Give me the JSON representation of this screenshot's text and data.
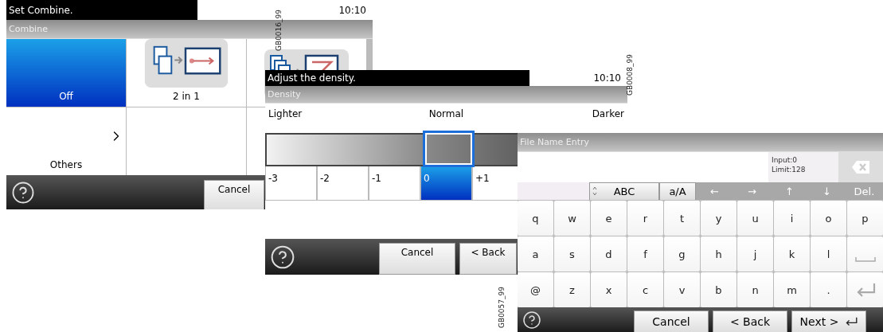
{
  "combine_screen": {
    "message": "Set Combine.",
    "time": "10:10",
    "title": "Combine",
    "options": [
      {
        "kind": "option",
        "label": "Off",
        "selected": true
      },
      {
        "kind": "option",
        "label": "2 in 1",
        "selected": false
      },
      {
        "kind": "icon_only",
        "selected": false
      },
      {
        "kind": "more",
        "label": "Others"
      }
    ],
    "buttons": [
      "Cancel"
    ]
  },
  "density_screen": {
    "message": "Adjust the density.",
    "time": "10:10",
    "title": "Density",
    "scale_labels": [
      "Lighter",
      "Normal",
      "Darker"
    ],
    "steps": [
      {
        "label": "-3",
        "selected": false
      },
      {
        "label": "-2",
        "selected": false
      },
      {
        "label": "-1",
        "selected": false
      },
      {
        "label": "0",
        "selected": true
      },
      {
        "label": "+1",
        "selected": false
      }
    ],
    "buttons": [
      "Cancel",
      "< Back"
    ]
  },
  "file_name_screen": {
    "title": "File Name Entry",
    "input_count": "Input:0",
    "limit": "Limit:128",
    "mode_keys": [
      {
        "kind": "cycle",
        "label": "ABC"
      },
      {
        "kind": "plain",
        "label": "a/A"
      }
    ],
    "nav_keys": [
      {
        "label": "←",
        "disabled": true
      },
      {
        "label": "→",
        "disabled": true
      },
      {
        "label": "↑",
        "disabled": true
      },
      {
        "label": "↓",
        "disabled": true
      },
      {
        "label": "Del.",
        "disabled": true
      }
    ],
    "key_rows": [
      [
        {
          "kind": "char",
          "label": "q"
        },
        {
          "kind": "char",
          "label": "w"
        },
        {
          "kind": "char",
          "label": "e"
        },
        {
          "kind": "char",
          "label": "r"
        },
        {
          "kind": "char",
          "label": "t"
        },
        {
          "kind": "char",
          "label": "y"
        },
        {
          "kind": "char",
          "label": "u"
        },
        {
          "kind": "char",
          "label": "i"
        },
        {
          "kind": "char",
          "label": "o"
        },
        {
          "kind": "char",
          "label": "p"
        }
      ],
      [
        {
          "kind": "char",
          "label": "a"
        },
        {
          "kind": "char",
          "label": "s"
        },
        {
          "kind": "char",
          "label": "d"
        },
        {
          "kind": "char",
          "label": "f"
        },
        {
          "kind": "char",
          "label": "g"
        },
        {
          "kind": "char",
          "label": "h"
        },
        {
          "kind": "char",
          "label": "j"
        },
        {
          "kind": "char",
          "label": "k"
        },
        {
          "kind": "char",
          "label": "l"
        },
        {
          "kind": "space"
        }
      ],
      [
        {
          "kind": "char",
          "label": "@"
        },
        {
          "kind": "char",
          "label": "z"
        },
        {
          "kind": "char",
          "label": "x"
        },
        {
          "kind": "char",
          "label": "c"
        },
        {
          "kind": "char",
          "label": "v"
        },
        {
          "kind": "char",
          "label": "b"
        },
        {
          "kind": "char",
          "label": "n"
        },
        {
          "kind": "char",
          "label": "m"
        },
        {
          "kind": "char",
          "label": "."
        },
        {
          "kind": "enter"
        }
      ]
    ],
    "buttons": [
      {
        "kind": "plain",
        "label": "Cancel"
      },
      {
        "kind": "plain",
        "label": "< Back"
      },
      {
        "kind": "enter",
        "label": "Next >"
      }
    ]
  },
  "figure_codes": [
    "GB0016_99",
    "GB0008_99",
    "GB0057_99"
  ]
}
